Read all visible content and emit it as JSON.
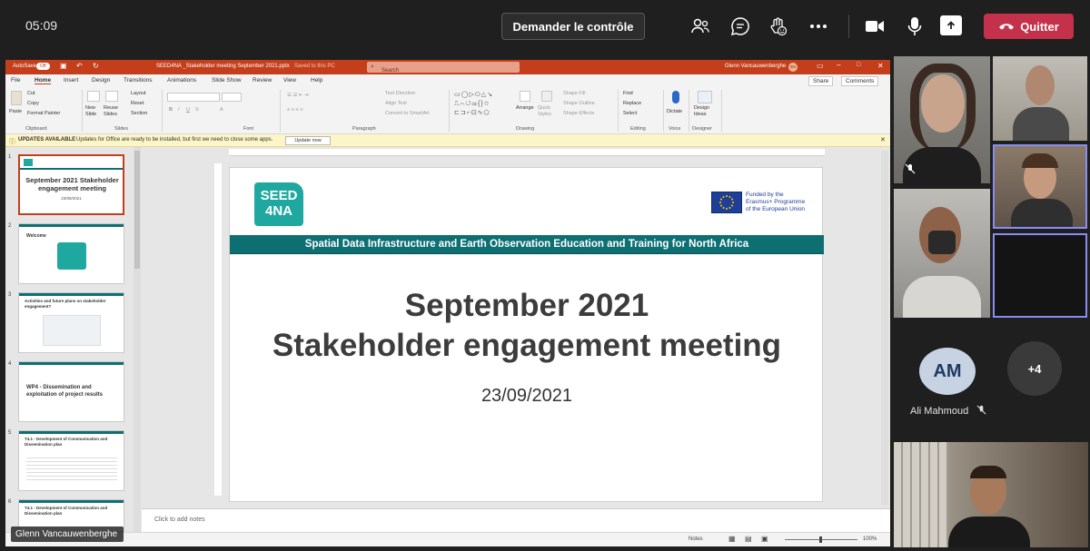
{
  "teams": {
    "time": "05:09",
    "request_control": "Demander le contrôle",
    "quit": "Quitter"
  },
  "ppt": {
    "autosave": "AutoSave",
    "autosave_state": "Off",
    "doc_title": "SEED4NA _Stakeholder meeting September 2021.pptx",
    "saved": "Saved to this PC",
    "search_placeholder": "Search",
    "user": "Glenn Vancauwenberghe",
    "user_initials": "GV",
    "tabs": [
      "File",
      "Home",
      "Insert",
      "Design",
      "Transitions",
      "Animations",
      "Slide Show",
      "Review",
      "View",
      "Help"
    ],
    "share": "Share",
    "comments": "Comments",
    "ribbon": {
      "paste": "Paste",
      "cut": "Cut",
      "copy": "Copy",
      "format_painter": "Format Painter",
      "clipboard": "Clipboard",
      "new_slide": "New Slide",
      "reuse_slides": "Reuse Slides",
      "layout": "Layout",
      "reset": "Reset",
      "section": "Section",
      "slides": "Slides",
      "font": "Font",
      "text_direction": "Text Direction",
      "align_text": "Align Text",
      "convert_smartart": "Convert to SmartArt",
      "paragraph": "Paragraph",
      "arrange": "Arrange",
      "quick_styles": "Quick Styles",
      "shape_fill": "Shape Fill",
      "shape_outline": "Shape Outline",
      "shape_effects": "Shape Effects",
      "drawing": "Drawing",
      "find": "Find",
      "replace": "Replace",
      "select": "Select",
      "editing": "Editing",
      "dictate": "Dictate",
      "voice": "Voice",
      "design_ideas": "Design Ideas",
      "designer": "Designer"
    },
    "update": {
      "title": "UPDATES AVAILABLE",
      "message": "Updates for Office are ready to be installed, but first we need to close some apps.",
      "button": "Update now"
    },
    "thumbnails": [
      {
        "num": "1",
        "title": "September 2021 Stakeholder engagement meeting",
        "sub": "23/09/2021"
      },
      {
        "num": "2",
        "title": "Welcome"
      },
      {
        "num": "3",
        "title": "Activities and future plans on stakeholder engagement?"
      },
      {
        "num": "4",
        "title": "WP4 - Dissemination and exploitation of project results"
      },
      {
        "num": "5",
        "title": "T4.1 - Development of Communication and Dissemination plan"
      },
      {
        "num": "6",
        "title": "T4.1 - Development of Communication and Dissemination plan"
      }
    ],
    "slide": {
      "logo_text_1": "SEED",
      "logo_text_2": "4NA",
      "eu_text": "Funded by the Erasmus+ Programme of the European Union",
      "band": "Spatial Data Infrastructure and Earth Observation Education and Training for North Africa",
      "title_line1": "September 2021",
      "title_line2": "Stakeholder engagement meeting",
      "date": "23/09/2021"
    },
    "notes_placeholder": "Click to add notes",
    "status_notes": "Notes",
    "zoom": "100%"
  },
  "presenter": "Glenn Vancauwenberghe",
  "participants": {
    "avatar_initials": "AM",
    "avatar_name": "Ali Mahmoud",
    "more": "+4"
  }
}
